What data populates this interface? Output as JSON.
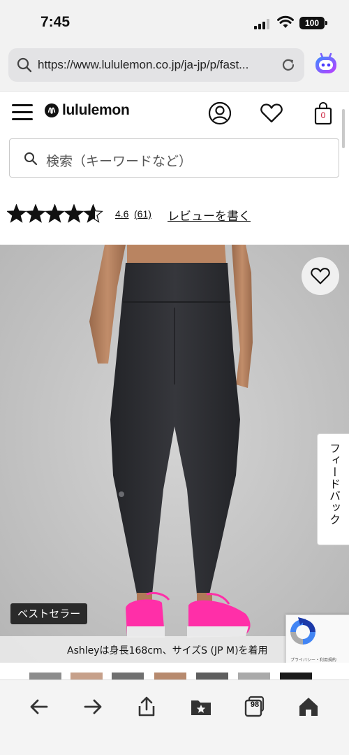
{
  "status_bar": {
    "time": "7:45",
    "battery": "100"
  },
  "browser": {
    "url": "https://www.lululemon.co.jp/ja-jp/p/fast...",
    "tab_count": "98"
  },
  "header": {
    "brand": "lululemon",
    "bag_count": "0"
  },
  "search": {
    "placeholder": "検索（キーワードなど）"
  },
  "rating": {
    "stars": 4.6,
    "value": "4.6",
    "count": "(61)",
    "write_review": "レビューを書く"
  },
  "product": {
    "badge": "ベストセラー",
    "model_caption": "Ashleyは身長168cm、サイズS (JP M)を着用",
    "feedback_tab": "フィードバック"
  },
  "recaptcha": {
    "links": "プライバシー・利用規約"
  },
  "colors": {
    "shoe_pink": "#ff2fa8",
    "legging": "#2e2f33",
    "brand_red": "#c8102e"
  }
}
